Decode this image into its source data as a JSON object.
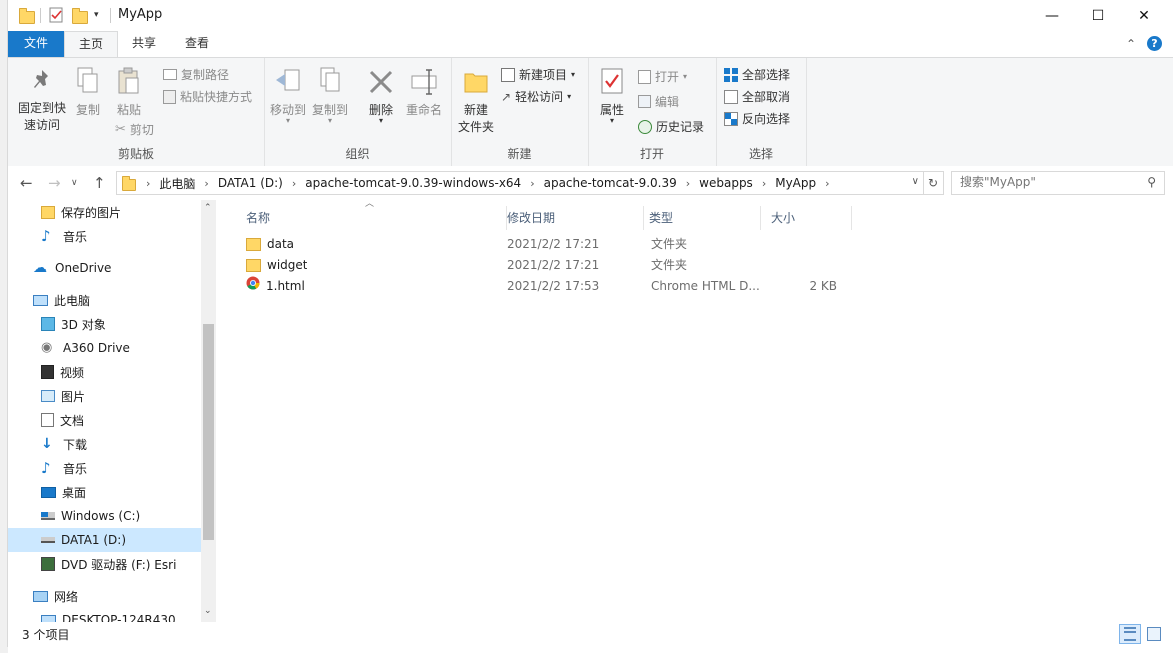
{
  "window": {
    "title": "MyApp"
  },
  "title_controls": {
    "minimize": "—",
    "maximize": "☐",
    "close": "✕"
  },
  "ribbon_tabs": [
    "文件",
    "主页",
    "共享",
    "查看"
  ],
  "ribbon": {
    "clipboard": {
      "label": "剪贴板",
      "pin": "固定到快速访问",
      "pin_line1": "固定到快",
      "pin_line2": "速访问",
      "copy": "复制",
      "paste": "粘贴",
      "copy_path": "复制路径",
      "paste_shortcut": "粘贴快捷方式",
      "cut": "剪切"
    },
    "organize": {
      "label": "组织",
      "move_to": "移动到",
      "copy_to": "复制到",
      "delete": "删除",
      "rename": "重命名"
    },
    "new": {
      "label": "新建",
      "new_folder_line1": "新建",
      "new_folder_line2": "文件夹",
      "new_item": "新建项目",
      "easy_access": "轻松访问"
    },
    "open": {
      "label": "打开",
      "properties": "属性",
      "open": "打开",
      "edit": "编辑",
      "history": "历史记录"
    },
    "select": {
      "label": "选择",
      "select_all": "全部选择",
      "select_none": "全部取消",
      "invert": "反向选择"
    }
  },
  "address": {
    "crumbs": [
      "此电脑",
      "DATA1 (D:)",
      "apache-tomcat-9.0.39-windows-x64",
      "apache-tomcat-9.0.39",
      "webapps",
      "MyApp"
    ]
  },
  "search": {
    "placeholder": "搜索\"MyApp\""
  },
  "nav_pane": {
    "items": [
      {
        "label": "保存的图片",
        "icon": "folder-icon"
      },
      {
        "label": "音乐",
        "icon": "music-icon"
      },
      {
        "label": "OneDrive",
        "icon": "cloud-icon"
      },
      {
        "label": "此电脑",
        "icon": "computer-icon"
      },
      {
        "label": "3D 对象",
        "icon": "cube-icon"
      },
      {
        "label": "A360 Drive",
        "icon": "drive-icon"
      },
      {
        "label": "视频",
        "icon": "video-icon"
      },
      {
        "label": "图片",
        "icon": "picture-icon"
      },
      {
        "label": "文档",
        "icon": "document-icon"
      },
      {
        "label": "下载",
        "icon": "download-icon"
      },
      {
        "label": "音乐",
        "icon": "music-icon"
      },
      {
        "label": "桌面",
        "icon": "desktop-icon"
      },
      {
        "label": "Windows (C:)",
        "icon": "windows-drive-icon"
      },
      {
        "label": "DATA1 (D:)",
        "icon": "hard-drive-icon"
      },
      {
        "label": "DVD 驱动器 (F:) Esri",
        "icon": "dvd-icon"
      },
      {
        "label": "网络",
        "icon": "network-icon"
      },
      {
        "label": "DESKTOP-124R430",
        "icon": "computer-icon"
      }
    ]
  },
  "file_list": {
    "columns": [
      "名称",
      "修改日期",
      "类型",
      "大小"
    ],
    "rows": [
      {
        "name": "data",
        "date": "2021/2/2 17:21",
        "type": "文件夹",
        "size": "",
        "icon": "folder-icon"
      },
      {
        "name": "widget",
        "date": "2021/2/2 17:21",
        "type": "文件夹",
        "size": "",
        "icon": "folder-icon"
      },
      {
        "name": "1.html",
        "date": "2021/2/2 17:53",
        "type": "Chrome HTML D...",
        "size": "2 KB",
        "icon": "chrome-icon"
      }
    ]
  },
  "status": {
    "item_count": "3 个项目"
  }
}
